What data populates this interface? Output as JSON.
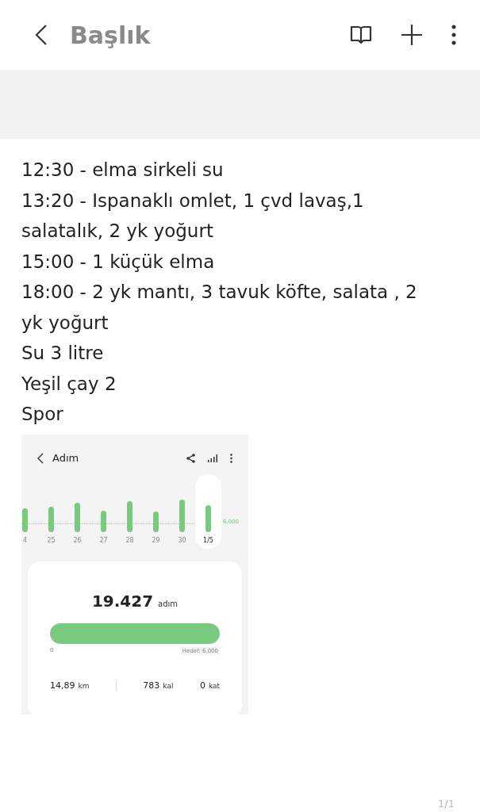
{
  "header": {
    "title": "Başlık"
  },
  "note_lines": [
    "12:30 - elma sirkeli su",
    "13:20 - Ispanaklı omlet, 1 çvd lavaş,1 salatalık, 2 yk yoğurt",
    "15:00 - 1 küçük elma",
    "18:00 - 2 yk mantı, 3 tavuk köfte, salata , 2 yk yoğurt",
    "Su 3 litre",
    "Yeşil çay 2",
    "Spor"
  ],
  "steps_screenshot": {
    "title": "Adım",
    "days": [
      {
        "label": "4",
        "selected": false
      },
      {
        "label": "25",
        "selected": false
      },
      {
        "label": "26",
        "selected": false
      },
      {
        "label": "27",
        "selected": false
      },
      {
        "label": "28",
        "selected": false
      },
      {
        "label": "29",
        "selected": false
      },
      {
        "label": "30",
        "selected": false
      },
      {
        "label": "1/5",
        "selected": true
      }
    ],
    "goal_line_label": "6,000",
    "steps": "19.427",
    "steps_unit": "adım",
    "progress": {
      "level": 1,
      "start": "0",
      "goal": "Hedef: 6,000"
    },
    "stats": [
      {
        "value": "14,89",
        "unit": "km"
      },
      {
        "value": "783",
        "unit": "kal"
      },
      {
        "value": "0",
        "unit": "kat"
      }
    ]
  },
  "page_indicator": "1/1"
}
